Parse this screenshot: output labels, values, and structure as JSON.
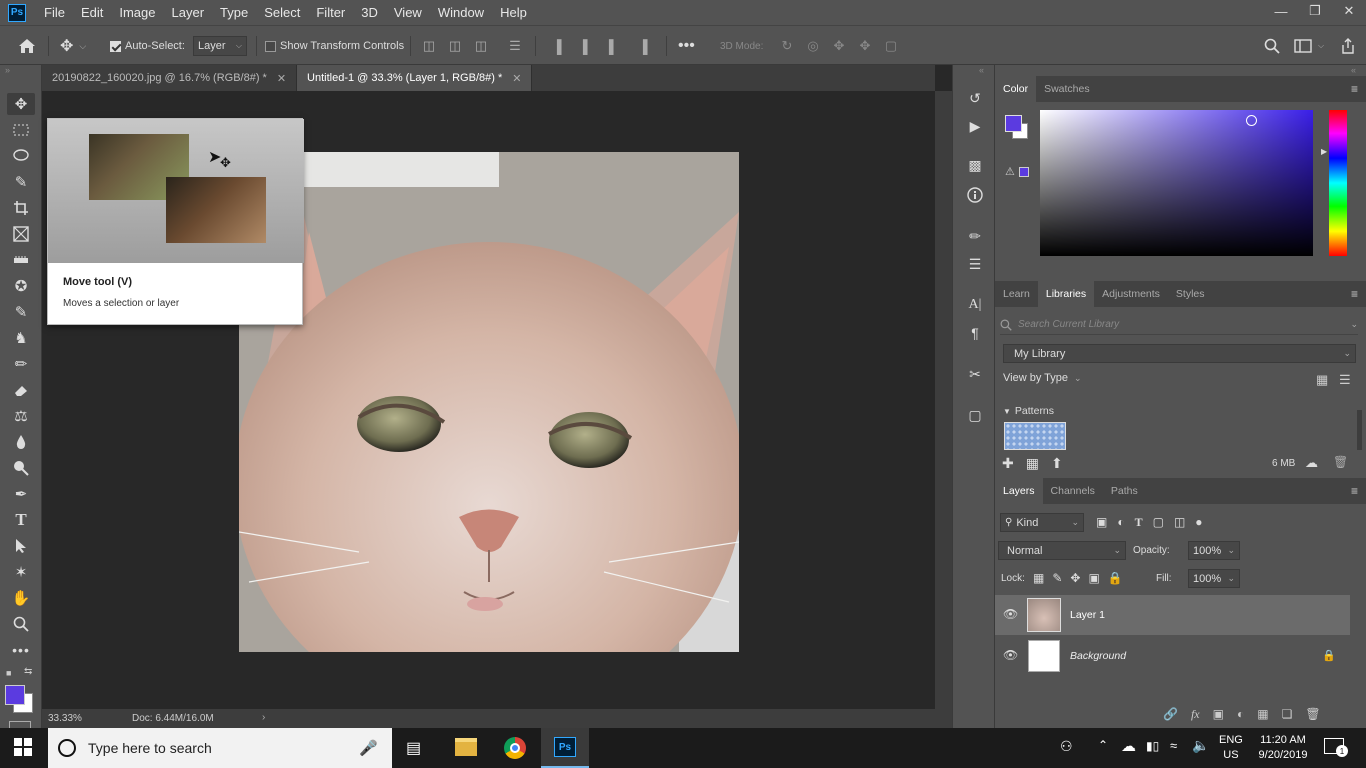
{
  "menubar": {
    "logo": "Ps",
    "items": [
      "File",
      "Edit",
      "Image",
      "Layer",
      "Type",
      "Select",
      "Filter",
      "3D",
      "View",
      "Window",
      "Help"
    ]
  },
  "options": {
    "auto_select_label": "Auto-Select:",
    "auto_select_checked": true,
    "auto_select_value": "Layer",
    "show_transform_label": "Show Transform Controls",
    "three_d_mode_label": "3D Mode:"
  },
  "tabs": [
    {
      "label": "20190822_160020.jpg @ 16.7% (RGB/8#) *",
      "active": false
    },
    {
      "label": "Untitled-1 @ 33.3% (Layer 1, RGB/8#) *",
      "active": true
    }
  ],
  "tooltip": {
    "title": "Move tool (V)",
    "description": "Moves a selection or layer"
  },
  "status": {
    "zoom": "33.33%",
    "doc": "Doc: 6.44M/16.0M"
  },
  "color_panel": {
    "tabs": [
      "Color",
      "Swatches"
    ],
    "foreground": "#5b3be0",
    "background": "#ffffff",
    "hue_color": "#3a1fe8"
  },
  "libraries_panel": {
    "tabs": [
      "Learn",
      "Libraries",
      "Adjustments",
      "Styles"
    ],
    "search_placeholder": "Search Current Library",
    "library_name": "My Library",
    "view_by": "View by Type",
    "section": "Patterns",
    "size": "6 MB"
  },
  "layers_panel": {
    "tabs": [
      "Layers",
      "Channels",
      "Paths"
    ],
    "filter_kind": "Kind",
    "blend_mode": "Normal",
    "opacity_label": "Opacity:",
    "opacity": "100%",
    "lock_label": "Lock:",
    "fill_label": "Fill:",
    "fill": "100%",
    "layers": [
      {
        "name": "Layer 1",
        "selected": true
      },
      {
        "name": "Background",
        "selected": false
      }
    ]
  },
  "taskbar": {
    "search_placeholder": "Type here to search",
    "lang_top": "ENG",
    "lang_bottom": "US",
    "time": "11:20 AM",
    "date": "9/20/2019",
    "notif_count": "1"
  }
}
